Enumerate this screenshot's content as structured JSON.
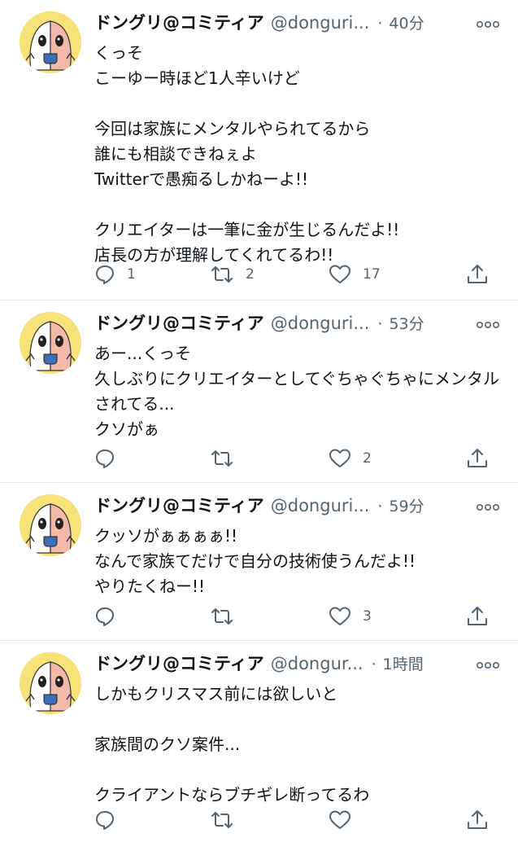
{
  "tweets": [
    {
      "name": "ドングリ@コミティア",
      "handle": "@donguri...",
      "time": "40分",
      "text": "くっそ\nこーゆー時ほど1人辛いけど\n\n今回は家族にメンタルやられてるから\n誰にも相談できねぇよ\nTwitterで愚痴るしかねーよ!!\n\nクリエイターは一筆に金が生じるんだよ!!\n店長の方が理解してくれてるわ!!",
      "replies": "1",
      "retweets": "2",
      "likes": "17"
    },
    {
      "name": "ドングリ@コミティア",
      "handle": "@donguri...",
      "time": "53分",
      "text": "あー...くっそ\n久しぶりにクリエイターとしてぐちゃぐちゃにメンタルされてる...\nクソがぁ",
      "replies": "",
      "retweets": "",
      "likes": "2"
    },
    {
      "name": "ドングリ@コミティア",
      "handle": "@donguri...",
      "time": "59分",
      "text": "クッソがぁぁぁぁ!!\nなんで家族てだけで自分の技術使うんだよ!!\nやりたくねー!!",
      "replies": "",
      "retweets": "",
      "likes": "3"
    },
    {
      "name": "ドングリ@コミティア",
      "handle": "@dongur...",
      "time": "1時間",
      "text": "しかもクリスマス前には欲しいと\n\n家族間のクソ案件...\n\nクライアントならブチギレ断ってるわ",
      "replies": "",
      "retweets": "",
      "likes": ""
    }
  ],
  "icons": {
    "reply": "speech-bubble-icon",
    "retweet": "retweet-arrows-icon",
    "like": "heart-outline-icon",
    "share": "share-upload-icon",
    "more": "more-dots-icon"
  },
  "colors": {
    "text": "#0f1419",
    "secondary": "#536471",
    "divider": "#e1e8ed",
    "avatar_bg": "#f7e27a"
  }
}
